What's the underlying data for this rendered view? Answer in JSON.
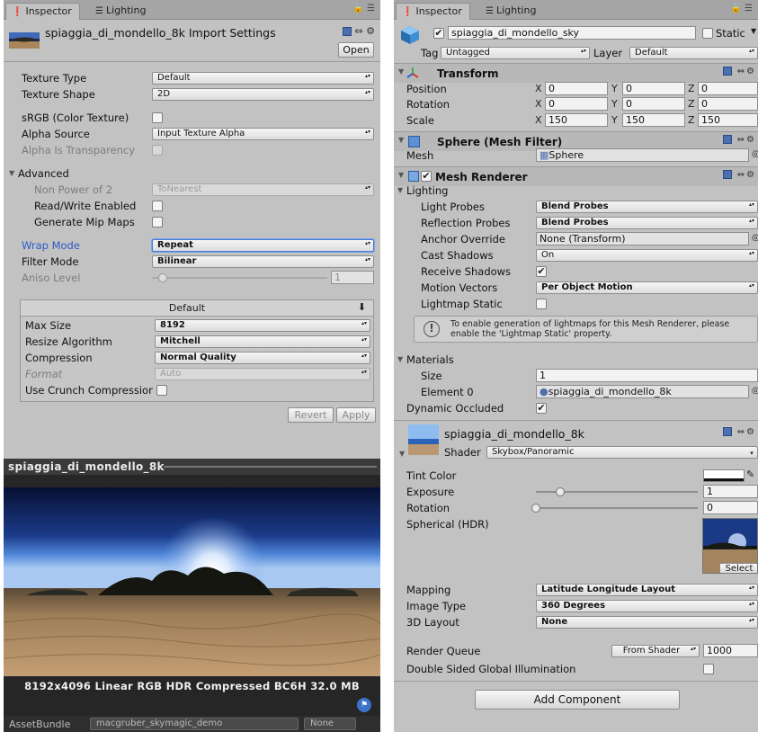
{
  "left": {
    "tabs": {
      "inspector": "Inspector",
      "lighting": "Lighting"
    },
    "header": {
      "title": "spiaggia_di_mondello_8k Import Settings",
      "open_button": "Open"
    },
    "texture_type": {
      "label": "Texture Type",
      "value": "Default"
    },
    "texture_shape": {
      "label": "Texture Shape",
      "value": "2D"
    },
    "srgb": {
      "label": "sRGB (Color Texture)",
      "checked": ""
    },
    "alpha_source": {
      "label": "Alpha Source",
      "value": "Input Texture Alpha"
    },
    "alpha_transparency": {
      "label": "Alpha Is Transparency",
      "checked": ""
    },
    "advanced": {
      "label": "Advanced"
    },
    "npot": {
      "label": "Non Power of 2",
      "value": "ToNearest"
    },
    "read_write": {
      "label": "Read/Write Enabled",
      "checked": ""
    },
    "mipmaps": {
      "label": "Generate Mip Maps",
      "checked": ""
    },
    "wrap_mode": {
      "label": "Wrap Mode",
      "value": "Repeat"
    },
    "filter_mode": {
      "label": "Filter Mode",
      "value": "Bilinear"
    },
    "aniso": {
      "label": "Aniso Level",
      "value": "1"
    },
    "platform": {
      "tab": "Default",
      "download_icon": "⬇"
    },
    "max_size": {
      "label": "Max Size",
      "value": "8192"
    },
    "resize": {
      "label": "Resize Algorithm",
      "value": "Mitchell"
    },
    "compression": {
      "label": "Compression",
      "value": "Normal Quality"
    },
    "format": {
      "label": "Format",
      "value": "Auto"
    },
    "crunch": {
      "label": "Use Crunch Compressior",
      "checked": ""
    },
    "revert_button": "Revert",
    "apply_button": "Apply",
    "preview": {
      "title": "spiaggia_di_mondello_8k",
      "info": "8192x4096 Linear  RGB HDR Compressed BC6H   32.0 MB"
    },
    "asset_bundle": {
      "label": "AssetBundle",
      "name": "macgruber_skymagic_demo",
      "variant": "None"
    }
  },
  "right": {
    "tabs": {
      "inspector": "Inspector",
      "lighting": "Lighting"
    },
    "object": {
      "active_check": "✔",
      "name": "spiaggia_di_mondello_sky",
      "static_label": "Static",
      "tag_label": "Tag",
      "tag_value": "Untagged",
      "layer_label": "Layer",
      "layer_value": "Default"
    },
    "transform": {
      "title": "Transform",
      "position": {
        "label": "Position",
        "x": "0",
        "y": "0",
        "z": "0"
      },
      "rotation": {
        "label": "Rotation",
        "x": "0",
        "y": "0",
        "z": "0"
      },
      "scale": {
        "label": "Scale",
        "x": "150",
        "y": "150",
        "z": "150"
      },
      "axis_x": "X",
      "axis_y": "Y",
      "axis_z": "Z"
    },
    "mesh_filter": {
      "title": "Sphere (Mesh Filter)",
      "mesh_label": "Mesh",
      "mesh_value": "Sphere"
    },
    "mesh_renderer": {
      "title": "Mesh Renderer",
      "enabled_check": "✔",
      "lighting_label": "Lighting",
      "light_probes": {
        "label": "Light Probes",
        "value": "Blend Probes"
      },
      "reflection_probes": {
        "label": "Reflection Probes",
        "value": "Blend Probes"
      },
      "anchor_override": {
        "label": "Anchor Override",
        "value": "None (Transform)"
      },
      "cast_shadows": {
        "label": "Cast Shadows",
        "value": "On"
      },
      "receive_shadows": {
        "label": "Receive Shadows",
        "checked": "✔"
      },
      "motion_vectors": {
        "label": "Motion Vectors",
        "value": "Per Object Motion"
      },
      "lightmap_static": {
        "label": "Lightmap Static",
        "checked": ""
      },
      "info_line1": "To enable generation of lightmaps for this Mesh Renderer, please",
      "info_line2": "enable the 'Lightmap Static' property.",
      "materials_label": "Materials",
      "size": {
        "label": "Size",
        "value": "1"
      },
      "element0": {
        "label": "Element 0",
        "value": "spiaggia_di_mondello_8k"
      },
      "dynamic_occluded": {
        "label": "Dynamic Occluded",
        "checked": "✔"
      }
    },
    "material": {
      "name": "spiaggia_di_mondello_8k",
      "shader_label": "Shader",
      "shader_value": "Skybox/Panoramic",
      "tint_color": {
        "label": "Tint Color"
      },
      "exposure": {
        "label": "Exposure",
        "value": "1",
        "fraction": 0.15
      },
      "rotation": {
        "label": "Rotation",
        "value": "0",
        "fraction": 0.0
      },
      "spherical": {
        "label": "Spherical  (HDR)",
        "select_button": "Select"
      },
      "mapping": {
        "label": "Mapping",
        "value": "Latitude Longitude Layout"
      },
      "image_type": {
        "label": "Image Type",
        "value": "360 Degrees"
      },
      "layout_3d": {
        "label": "3D Layout",
        "value": "None"
      },
      "render_queue": {
        "label": "Render Queue",
        "mode": "From Shader",
        "value": "1000"
      },
      "double_sided": {
        "label": "Double Sided Global Illumination",
        "checked": ""
      }
    },
    "add_component_button": "Add Component"
  },
  "colors": {
    "panel_bg": "#c2c2c2",
    "accent_blue": "#2b5cc6",
    "preview_bg": "#262626"
  },
  "icons": {
    "inspector": "info-circle-icon",
    "lighting": "lighting-icon",
    "lock": "lock-icon",
    "menu": "menu-icon",
    "settings": "gear-icon",
    "help": "book-help-icon",
    "transform": "transform-axes-icon",
    "mesh_filter": "mesh-filter-icon",
    "mesh_renderer": "mesh-renderer-icon",
    "cube": "cube-icon",
    "info": "info-icon",
    "object_picker": "object-picker-icon",
    "color_picker": "eyedropper-icon",
    "asset_tag": "asset-tag-icon"
  }
}
